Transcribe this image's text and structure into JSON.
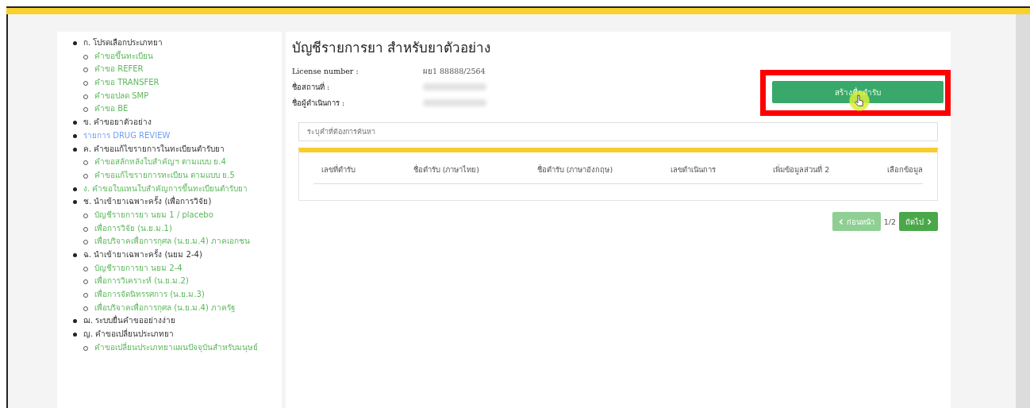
{
  "sidebar": {
    "items": [
      {
        "label": "ก. โปรดเลือกประเภทยา",
        "kind": "heading",
        "children": [
          {
            "label": "คำขอขึ้นทะเบียน",
            "kind": "link"
          },
          {
            "label": "คำขอ REFER",
            "kind": "link"
          },
          {
            "label": "คำขอ TRANSFER",
            "kind": "link"
          },
          {
            "label": "คำขอปลด SMP",
            "kind": "link"
          },
          {
            "label": "คำขอ BE",
            "kind": "link"
          }
        ]
      },
      {
        "label": "ข. คำขอยาตัวอย่าง",
        "kind": "heading"
      },
      {
        "label": "รายการ DRUG REVIEW",
        "kind": "special"
      },
      {
        "label": "ค. คำขอแก้ไขรายการในทะเบียนตำรับยา",
        "kind": "heading",
        "children": [
          {
            "label": "คำขอสลักหลังใบสำคัญฯ ตามแบบ ย.4",
            "kind": "link"
          },
          {
            "label": "คำขอแก้ไขรายการทะเบียน ตามแบบ ย.5",
            "kind": "link"
          }
        ]
      },
      {
        "label": "ง. คำขอใบแทนใบสำคัญการขึ้นทะเบียนตำรับยา",
        "kind": "link"
      },
      {
        "label": "ช. นำเข้ายาเฉพาะครั้ง (เพื่อการวิจัย)",
        "kind": "heading",
        "children": [
          {
            "label": "บัญชีรายการยา นยม 1 / placebo",
            "kind": "link"
          },
          {
            "label": "เพื่อการวิจัย (น.ย.ม.1)",
            "kind": "link"
          },
          {
            "label": "เพื่อบริจาคเพื่อการกุศล (น.ย.ม.4) ภาคเอกชน",
            "kind": "link"
          }
        ]
      },
      {
        "label": "ฉ. นำเข้ายาเฉพาะครั้ง (นยม 2-4)",
        "kind": "heading",
        "children": [
          {
            "label": "บัญชีรายการยา นยม 2-4",
            "kind": "link"
          },
          {
            "label": "เพื่อการวิเคราะห์ (น.ย.ม.2)",
            "kind": "link"
          },
          {
            "label": "เพื่อการจัดนิทรรศการ (น.ย.ม.3)",
            "kind": "link"
          },
          {
            "label": "เพื่อบริจาคเพื่อการกุศล (น.ย.ม.4) ภาครัฐ",
            "kind": "link"
          }
        ]
      },
      {
        "label": "ฌ. ระบบยื่นคำขออย่างง่าย",
        "kind": "heading"
      },
      {
        "label": "ญ. คำขอเปลี่ยนประเภทยา",
        "kind": "heading",
        "children": [
          {
            "label": "คำขอเปลี่ยนประเภทยาแผนปัจจุบันสำหรับมนุษย์",
            "kind": "link"
          }
        ]
      }
    ]
  },
  "main": {
    "title": "บัญชีรายการยา สำหรับยาตัวอย่าง",
    "info": [
      {
        "label": "License number :",
        "value": "ผย1 88888/2564"
      },
      {
        "label": "ชื่อสถานที่ :"
      },
      {
        "label": "ชื่อผู้ดำเนินการ :"
      }
    ],
    "create_button": "สร้างชื่อตำรับ",
    "search": {
      "placeholder": "ระบุคำที่ต้องการค้นหา"
    },
    "table": {
      "columns": [
        "เลขที่ตำรับ",
        "ชื่อตำรับ (ภาษาไทย)",
        "ชื่อตำรับ (ภาษาอังกฤษ)",
        "เลขดำเนินการ",
        "เพิ่มข้อมูลส่วนที่ 2",
        "เลือกข้อมูล"
      ]
    },
    "pagination": {
      "previous": {
        "label": "ก่อนหน้า",
        "disabled": true
      },
      "page": "1/2",
      "next": {
        "label": "ถัดไป",
        "disabled": false
      }
    }
  }
}
